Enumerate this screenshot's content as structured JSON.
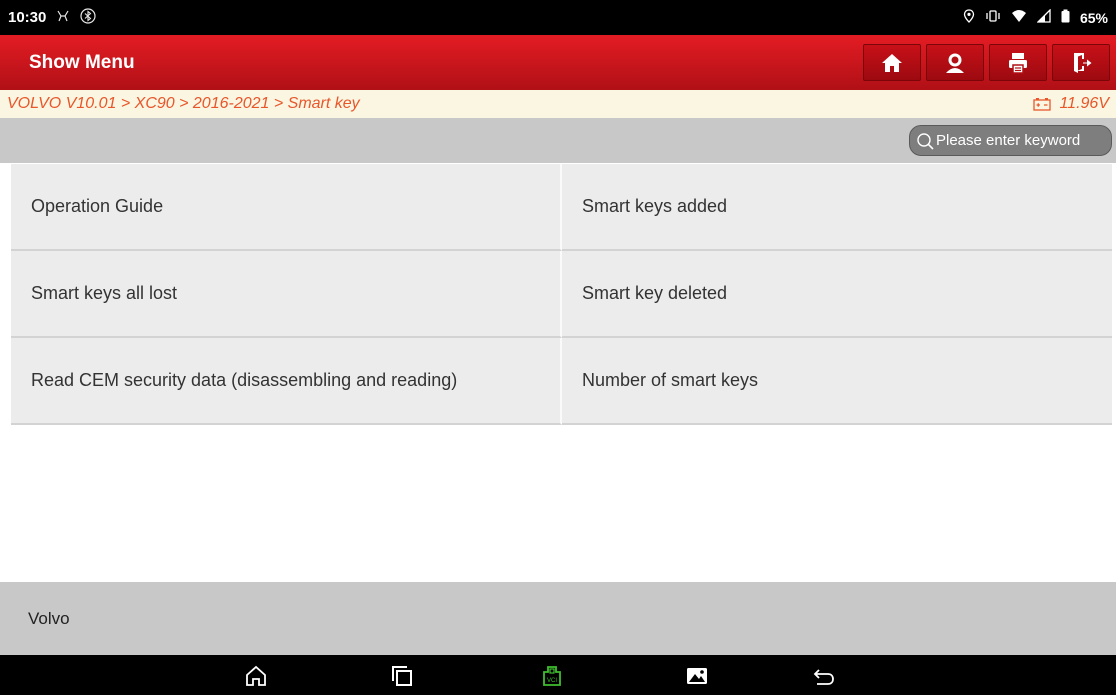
{
  "status_bar": {
    "time": "10:30",
    "battery": "65%"
  },
  "header": {
    "title": "Show Menu",
    "buttons": [
      "home-icon",
      "support-icon",
      "print-icon",
      "exit-icon"
    ]
  },
  "breadcrumb": {
    "path": "VOLVO V10.01 > XC90 > 2016-2021 > Smart key",
    "voltage": "11.96V"
  },
  "search": {
    "placeholder": "Please enter keyword"
  },
  "menu": {
    "items": [
      {
        "label": "Operation Guide"
      },
      {
        "label": "Smart keys added"
      },
      {
        "label": "Smart keys all lost"
      },
      {
        "label": "Smart key deleted"
      },
      {
        "label": "Read CEM security data (disassembling and reading)"
      },
      {
        "label": "Number of smart keys"
      }
    ]
  },
  "footer": {
    "text": "Volvo"
  },
  "colors": {
    "header_red": "#c8141b",
    "breadcrumb_text": "#e8562a",
    "vci_green": "#3fbf2f"
  }
}
